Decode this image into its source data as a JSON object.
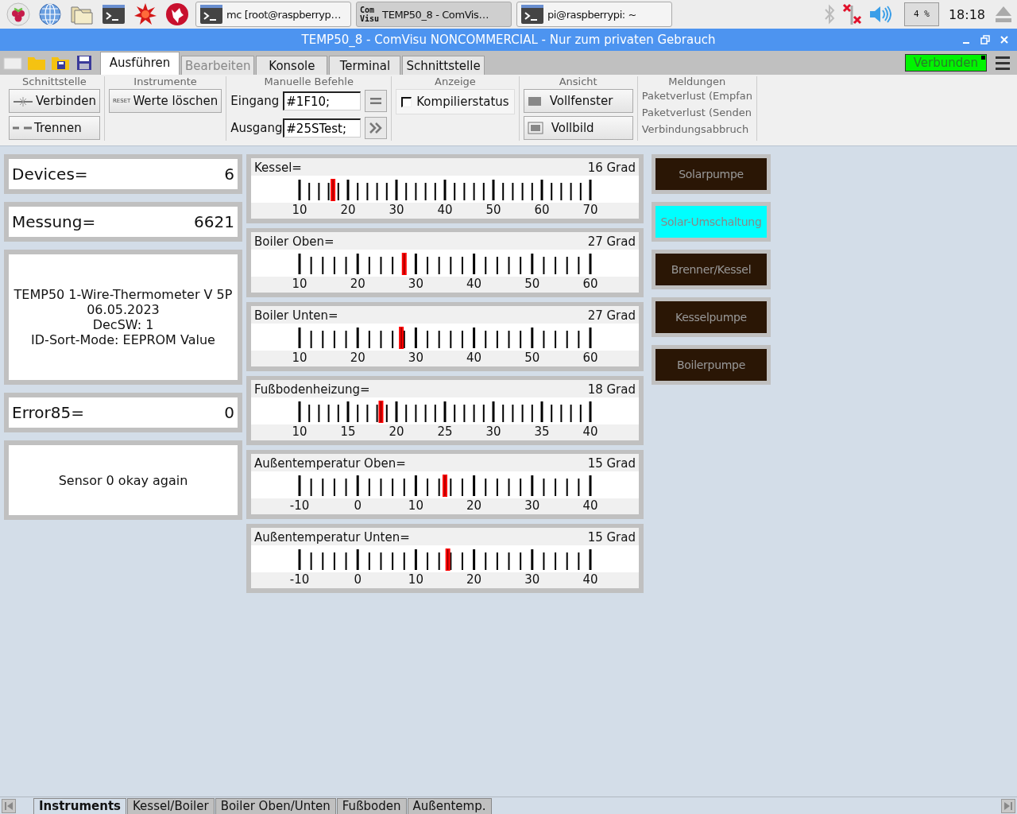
{
  "taskbar": {
    "tasks": [
      {
        "kind": "terminal",
        "label": "mc [root@raspberryp…",
        "selected": false
      },
      {
        "kind": "logo",
        "logo_text": [
          "Com",
          "Visu"
        ],
        "label": "TEMP50_8 - ComVis…",
        "selected": true
      },
      {
        "kind": "terminal",
        "label": "pi@raspberrypi: ~",
        "selected": false
      }
    ],
    "cpu": "4 %",
    "clock": "18:18"
  },
  "window": {
    "title": "TEMP50_8 - ComVisu NONCOMMERCIAL - Nur zum privaten Gebrauch"
  },
  "tabs": [
    {
      "label": "Ausführen",
      "selected": true,
      "disabled": false
    },
    {
      "label": "Bearbeiten",
      "selected": false,
      "disabled": true
    },
    {
      "label": "Konsole",
      "selected": false,
      "disabled": false
    },
    {
      "label": "Terminal",
      "selected": false,
      "disabled": false
    },
    {
      "label": "Schnittstelle",
      "selected": false,
      "disabled": false
    }
  ],
  "connection": {
    "label": "Verbunden",
    "connected": true
  },
  "ribbon": {
    "groups": [
      {
        "title": "Schnittstelle",
        "kind": "buttons",
        "buttons": [
          {
            "label": "Verbinden"
          },
          {
            "label": "Trennen"
          }
        ]
      },
      {
        "title": "Instrumente",
        "kind": "buttons",
        "buttons": [
          {
            "label": "Werte löschen",
            "icon_text": "RESET"
          }
        ]
      },
      {
        "title": "Manuelle Befehle",
        "kind": "commands",
        "rows": [
          {
            "label": "Eingang",
            "value": "#1F10;"
          },
          {
            "label": "Ausgang",
            "value": "#25STest;"
          }
        ]
      },
      {
        "title": "Anzeige",
        "kind": "checks",
        "items": [
          {
            "label": "Kompilierstatus",
            "checked": false
          }
        ]
      },
      {
        "title": "Ansicht",
        "kind": "buttons",
        "buttons": [
          {
            "label": "Vollfenster"
          },
          {
            "label": "Vollbild"
          }
        ]
      },
      {
        "title": "Meldungen",
        "kind": "messages",
        "items": [
          "Paketverlust (Empfan",
          "Paketverlust (Senden",
          "Verbindungsabbruch"
        ]
      }
    ]
  },
  "panels": [
    {
      "kind": "value",
      "label": "Devices=",
      "value": "6"
    },
    {
      "kind": "value",
      "label": "Messung=",
      "value": "6621"
    },
    {
      "kind": "text",
      "lines": [
        "TEMP50 1-Wire-Thermometer V 5P",
        "06.05.2023",
        "DecSW: 1",
        "ID-Sort-Mode: EEPROM Value"
      ]
    },
    {
      "kind": "value",
      "label": "Error85=",
      "value": "0"
    },
    {
      "kind": "text",
      "lines": [
        "Sensor 0 okay again"
      ]
    }
  ],
  "gauges": [
    {
      "name": "Kessel=",
      "reading": "16 Grad",
      "level": 0.115,
      "scale": [
        "10",
        "20",
        "30",
        "40",
        "50",
        "60",
        "70"
      ]
    },
    {
      "name": "Boiler Oben=",
      "reading": "27 Grad",
      "level": 0.36,
      "scale": [
        "10",
        "20",
        "30",
        "40",
        "50",
        "60"
      ]
    },
    {
      "name": "Boiler Unten=",
      "reading": "27 Grad",
      "level": 0.35,
      "scale": [
        "10",
        "20",
        "30",
        "40",
        "50",
        "60"
      ]
    },
    {
      "name": "Fußbodenheizung=",
      "reading": "18 Grad",
      "level": 0.28,
      "scale": [
        "10",
        "15",
        "20",
        "25",
        "30",
        "35",
        "40"
      ]
    },
    {
      "name": "Außentemperatur Oben=",
      "reading": "15 Grad",
      "level": 0.5,
      "scale": [
        "-10",
        "0",
        "10",
        "20",
        "30",
        "40"
      ]
    },
    {
      "name": "Außentemperatur Unten=",
      "reading": "15 Grad",
      "level": 0.51,
      "scale": [
        "-10",
        "0",
        "10",
        "20",
        "30",
        "40"
      ]
    }
  ],
  "outputs": [
    {
      "label": "Solarpumpe",
      "on": false
    },
    {
      "label": "Solar-Umschaltung",
      "on": true
    },
    {
      "label": "Brenner/Kessel",
      "on": false
    },
    {
      "label": "Kesselpumpe",
      "on": false
    },
    {
      "label": "Boilerpumpe",
      "on": false
    }
  ],
  "sheet_tabs": [
    {
      "label": "Instruments",
      "selected": true
    },
    {
      "label": "Kessel/Boiler",
      "selected": false
    },
    {
      "label": "Boiler Oben/Unten",
      "selected": false
    },
    {
      "label": "Fußboden",
      "selected": false
    },
    {
      "label": "Außentemp.",
      "selected": false
    }
  ]
}
